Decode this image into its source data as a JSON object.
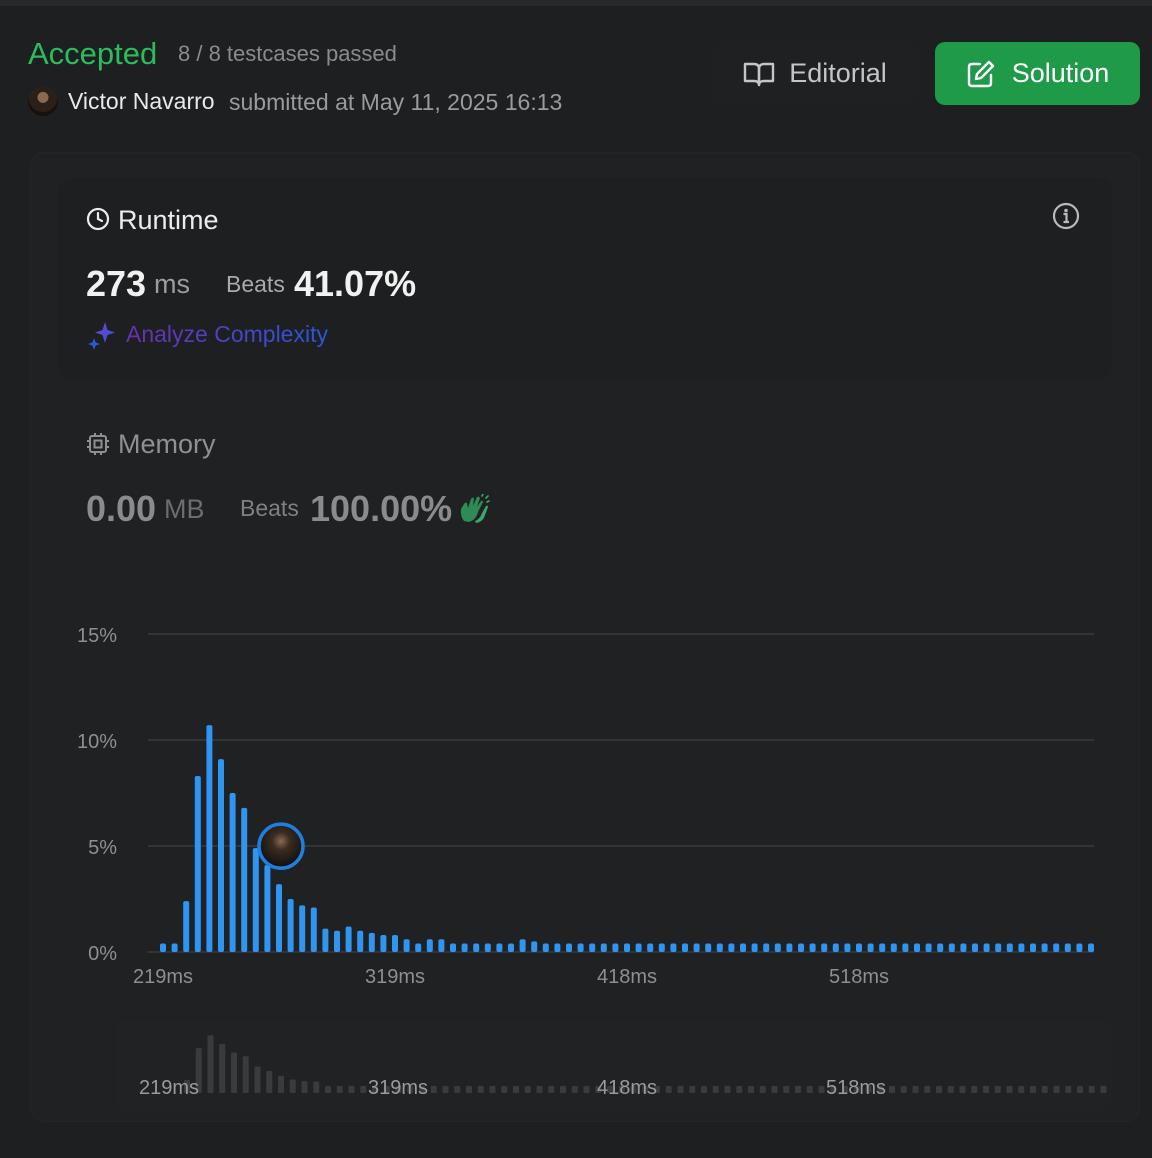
{
  "header": {
    "status": "Accepted",
    "testcases": "8 / 8 testcases passed",
    "username": "Victor Navarro",
    "submitted": "submitted at May 11, 2025 16:13",
    "editorial_label": "Editorial",
    "solution_label": "Solution"
  },
  "runtime": {
    "title": "Runtime",
    "value": "273",
    "unit": "ms",
    "beats_label": "Beats",
    "beats_value": "41.07%",
    "analyze_label": "Analyze Complexity"
  },
  "memory": {
    "title": "Memory",
    "value": "0.00",
    "unit": "MB",
    "beats_label": "Beats",
    "beats_value": "100.00%"
  },
  "colors": {
    "accepted": "#2cbb5d",
    "bar": "#2f95f2",
    "solution_button": "#1f9a48",
    "highlight_ring": "#1f7fe0"
  },
  "chart_data": {
    "type": "bar",
    "title": "",
    "xlabel": "",
    "ylabel": "",
    "ylim": [
      0,
      15
    ],
    "y_ticks": [
      "0%",
      "5%",
      "10%",
      "15%"
    ],
    "x_ticks": [
      "219ms",
      "319ms",
      "418ms",
      "518ms"
    ],
    "bin_start_ms": 219,
    "bin_width_ms": 5,
    "grid": true,
    "highlight_bin_index": 10,
    "series": [
      {
        "values": [
          0.4,
          0.4,
          2.4,
          8.3,
          10.7,
          9.1,
          7.5,
          6.8,
          4.9,
          4.1,
          3.2,
          2.5,
          2.2,
          2.1,
          1.1,
          1.0,
          1.2,
          1.0,
          0.9,
          0.8,
          0.8,
          0.6,
          0.4,
          0.6,
          0.6,
          0.4,
          0.4,
          0.4,
          0.4,
          0.4,
          0.4,
          0.6,
          0.5,
          0.4,
          0.4,
          0.4,
          0.4,
          0.4,
          0.4,
          0.4,
          0.4,
          0.4,
          0.4,
          0.4,
          0.4,
          0.4,
          0.4,
          0.4,
          0.4,
          0.4,
          0.4,
          0.4,
          0.4,
          0.4,
          0.4,
          0.4,
          0.4,
          0.4,
          0.4,
          0.4,
          0.4,
          0.4,
          0.4,
          0.4,
          0.4,
          0.4,
          0.4,
          0.4,
          0.4,
          0.4,
          0.4,
          0.4,
          0.4,
          0.4,
          0.4,
          0.4,
          0.4,
          0.4,
          0.4,
          0.4,
          0.4
        ]
      }
    ]
  }
}
